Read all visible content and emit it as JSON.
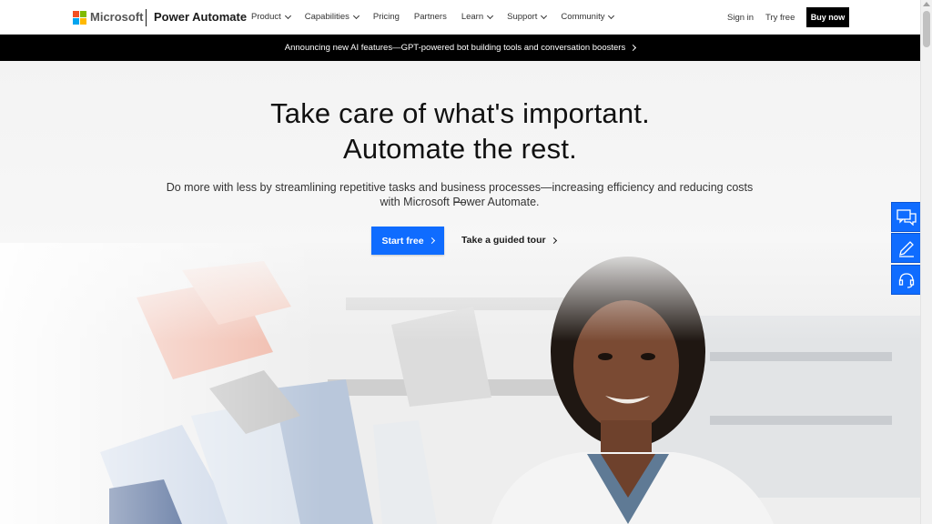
{
  "header": {
    "brand": "Microsoft",
    "product": "Power Automate",
    "nav": [
      {
        "label": "Product",
        "dropdown": true
      },
      {
        "label": "Capabilities",
        "dropdown": true
      },
      {
        "label": "Pricing",
        "dropdown": false
      },
      {
        "label": "Partners",
        "dropdown": false
      },
      {
        "label": "Learn",
        "dropdown": true
      },
      {
        "label": "Support",
        "dropdown": true
      },
      {
        "label": "Community",
        "dropdown": true
      }
    ],
    "sign_in": "Sign in",
    "try_free": "Try free",
    "buy_now": "Buy now"
  },
  "banner": {
    "text": "Announcing new AI features—GPT-powered bot building tools and conversation boosters"
  },
  "hero": {
    "title_line1": "Take care of what's important.",
    "title_line2": "Automate the rest.",
    "subtitle_line1": "Do more with less by streamlining repetitive tasks and business processes—increasing efficiency and reducing costs—",
    "subtitle_line2": "with Microsoft Power Automate.",
    "primary_cta": "Start free",
    "secondary_cta": "Take a guided tour"
  },
  "side_widgets": [
    {
      "icon": "chat-icon"
    },
    {
      "icon": "pencil-icon"
    },
    {
      "icon": "headset-icon"
    }
  ],
  "colors": {
    "accent": "#0f6cff",
    "banner_bg": "#000000",
    "logo_red": "#f25022",
    "logo_green": "#7fba00",
    "logo_blue": "#00a4ef",
    "logo_yellow": "#ffb900"
  }
}
